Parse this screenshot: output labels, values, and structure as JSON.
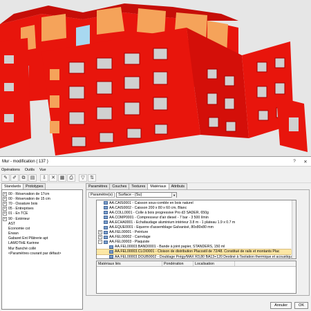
{
  "dialog": {
    "title": "Mur - modification  ( 137 )",
    "help_btn": "?",
    "close_btn": "✕",
    "menu": [
      "Opérations",
      "Outils",
      "Vue"
    ],
    "toolbar_icons": [
      "new-icon",
      "edit-icon",
      "copy-icon",
      "paste-icon",
      "import-icon",
      "delete-icon",
      "properties-icon",
      "print-icon",
      "filter-icon",
      "sort-icon"
    ],
    "left_tabs": [
      "Standards",
      "Prototypes"
    ],
    "tree": [
      {
        "label": "00 - Réservation de 17cm",
        "exp": true
      },
      {
        "label": "00 - Réservation de 15 cm",
        "exp": true
      },
      {
        "label": "70 - Ossature bois",
        "exp": true
      },
      {
        "label": "05 - Entreprises",
        "exp": true
      },
      {
        "label": "01 - En TCE",
        "exp": true
      },
      {
        "label": "90 - Extérieur",
        "exp": true
      },
      {
        "label": "AST",
        "exp": false
      },
      {
        "label": "Economie cst",
        "exp": false
      },
      {
        "label": "Erwan",
        "exp": false
      },
      {
        "label": "Gabaret Ent Plâtrerie apt",
        "exp": false
      },
      {
        "label": "LAMOTHE Karinne",
        "exp": false
      },
      {
        "label": "Mur Banché collé",
        "exp": false
      },
      {
        "label": "<Paramètres courant par défaut>",
        "exp": false
      }
    ],
    "right_tabs": [
      "Paramètres",
      "Couches",
      "Textures",
      "Matériaux",
      "Attributs"
    ],
    "right_active": "Matériaux",
    "param_label": "Paramètre(s)",
    "param_value": "Surface - (Su)",
    "materials": [
      {
        "indent": 1,
        "text": "AA.CAIS0001 - Caisson sous-comble en bois naturel"
      },
      {
        "indent": 1,
        "text": "AA.CAIS0002 - Caisson 200 x 80 x 60 cm, Blanc"
      },
      {
        "indent": 1,
        "text": "AA.COLL0001 - Colle à bois progressive Pro d3 SADER, 650g"
      },
      {
        "indent": 1,
        "text": "AA.COMP0001 - Compresseur d'air diesel - 7 bar - 3 500 l/min"
      },
      {
        "indent": 1,
        "text": "AA.ECHA0001 - Echafaudage aluminium intérieur 3.8 m - 1 plateau 1.9 x 0.7 m"
      },
      {
        "indent": 1,
        "text": "AA.EQUE0001 - Equerre d'assemblage Galvanisé, 80x80x80 mm"
      },
      {
        "indent": 0,
        "text": "AA.FEL00001 - Peinture",
        "exp": true
      },
      {
        "indent": 0,
        "text": "AA.FEL00002 - Carrelage",
        "exp": true
      },
      {
        "indent": 0,
        "text": "AA.FEL00003 - Plaquiste",
        "exp": true,
        "open": true
      },
      {
        "indent": 2,
        "text": "AA.FEL00003.BAND0001 - Bande à joint papier, STANDERS, 150 ml"
      },
      {
        "indent": 2,
        "text": "AA.FEL00003.CLOI0001 - Cloison de distribution Placostil de 72/48.  Constitué de rails et montants Plac",
        "sel": true
      },
      {
        "indent": 2,
        "text": "AA.FEL00003.DOUB0002 - Doublage Prégy/MAX R3,80 BA13+120  Destiné à l'isolation thermique et acoustique"
      }
    ],
    "table_headers": [
      "Matériaux liés",
      "Pondération",
      "Localisation"
    ],
    "buttons": {
      "cancel": "Annuler",
      "ok": "OK"
    }
  },
  "colors": {
    "wall_red": "#e8150c",
    "slab_orange": "#f5a35a",
    "glass_blue": "#a8d8f0",
    "selection": "#fde7a4"
  }
}
